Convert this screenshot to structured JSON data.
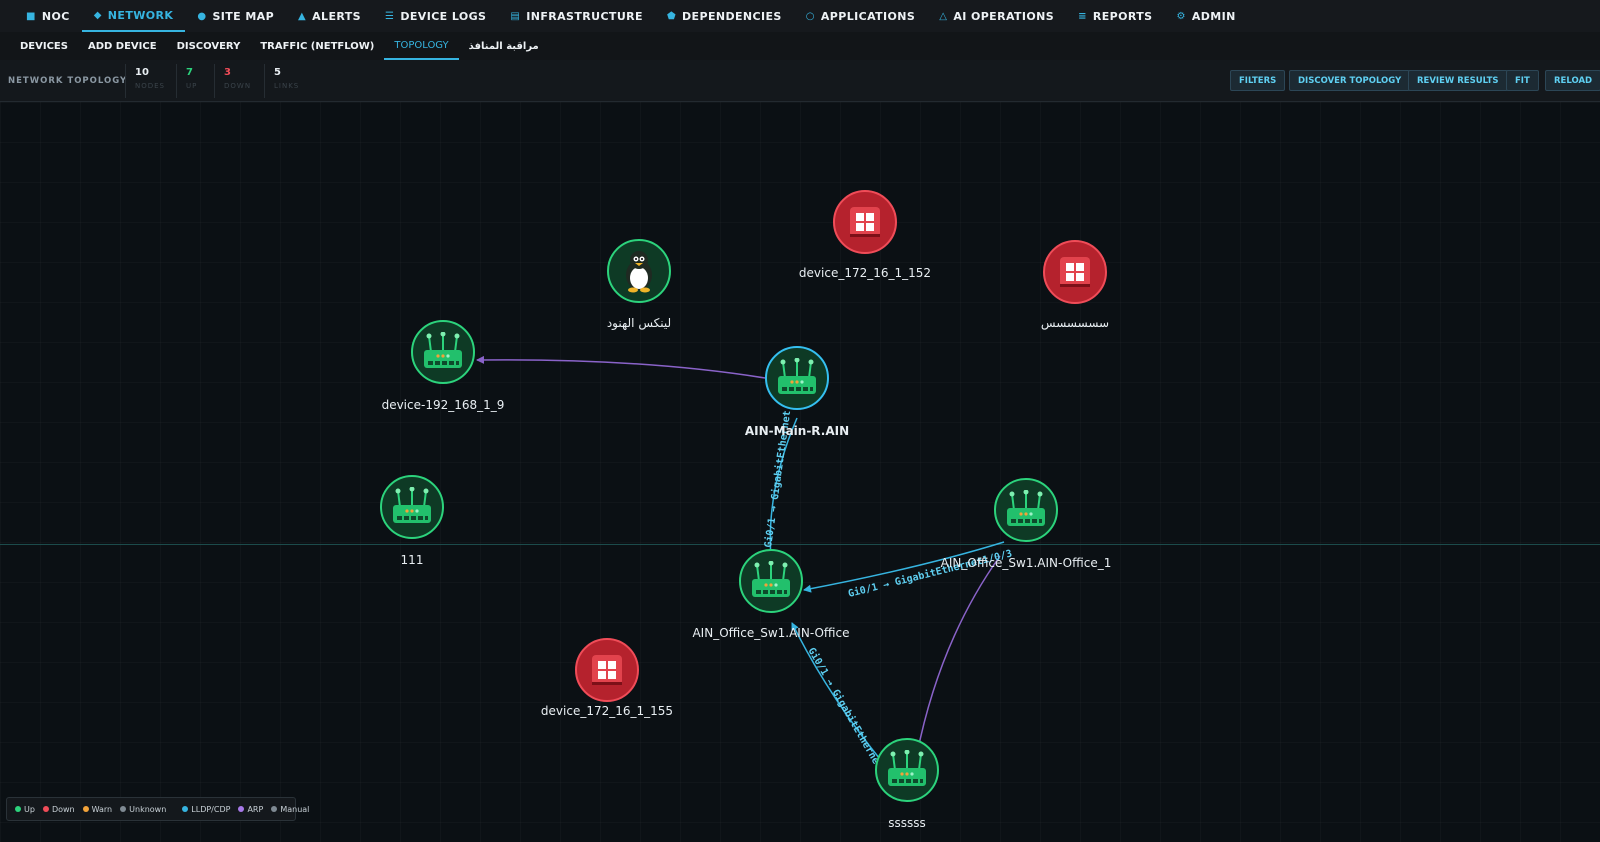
{
  "top_nav": [
    {
      "label": "NOC",
      "icon": "square-icon"
    },
    {
      "label": "NETWORK",
      "icon": "diamond-icon",
      "active": true
    },
    {
      "label": "SITE MAP",
      "icon": "globe-icon"
    },
    {
      "label": "ALERTS",
      "icon": "warning-icon"
    },
    {
      "label": "DEVICE LOGS",
      "icon": "list-icon"
    },
    {
      "label": "INFRASTRUCTURE",
      "icon": "server-icon"
    },
    {
      "label": "DEPENDENCIES",
      "icon": "pentagon-icon"
    },
    {
      "label": "APPLICATIONS",
      "icon": "circle-icon"
    },
    {
      "label": "AI OPERATIONS",
      "icon": "triangle-icon"
    },
    {
      "label": "REPORTS",
      "icon": "bars-icon"
    },
    {
      "label": "ADMIN",
      "icon": "gear-icon"
    }
  ],
  "sub_nav": [
    {
      "label": "DEVICES"
    },
    {
      "label": "ADD DEVICE"
    },
    {
      "label": "DISCOVERY"
    },
    {
      "label": "TRAFFIC (NETFLOW)"
    },
    {
      "label": "TOPOLOGY",
      "active": true
    },
    {
      "label": "مراقبة المنافذ"
    }
  ],
  "toolbar": {
    "title": "NETWORK TOPOLOGY",
    "stats": [
      {
        "value": "10",
        "label": "NODES",
        "color": "#e8eef2"
      },
      {
        "value": "7",
        "label": "UP",
        "color": "#2cd37c"
      },
      {
        "value": "3",
        "label": "DOWN",
        "color": "#f04c58"
      },
      {
        "value": "5",
        "label": "LINKS",
        "color": "#e8eef2"
      }
    ],
    "buttons": [
      "FILTERS",
      "DISCOVER TOPOLOGY",
      "REVIEW RESULTS",
      "FIT",
      "RELOAD"
    ]
  },
  "colors": {
    "up": "#2cd37c",
    "down": "#f04c58",
    "accent": "#36b4e0",
    "lldp": "#36b4e0",
    "arp": "#8a63c9"
  },
  "nodes": [
    {
      "id": "n1",
      "label": "device_172_16_1_152",
      "status": "down",
      "type": "windows-server"
    },
    {
      "id": "n2",
      "label": "لينكس الهنود",
      "status": "up",
      "type": "linux"
    },
    {
      "id": "n3",
      "label": "سسسسسس",
      "status": "down",
      "type": "windows-server"
    },
    {
      "id": "n4",
      "label": "device-192_168_1_9",
      "status": "up",
      "type": "router"
    },
    {
      "id": "n5",
      "label": "AIN-Main-R.AIN",
      "status": "selected",
      "type": "router"
    },
    {
      "id": "n6",
      "label": "111",
      "status": "up",
      "type": "router"
    },
    {
      "id": "n7",
      "label": "AIN_Office_Sw1.AIN-Office_1",
      "status": "up",
      "type": "router"
    },
    {
      "id": "n8",
      "label": "AIN_Office_Sw1.AIN-Office",
      "status": "up",
      "type": "router"
    },
    {
      "id": "n9",
      "label": "device_172_16_1_155",
      "status": "down",
      "type": "windows-server"
    },
    {
      "id": "n10",
      "label": "ssssss",
      "status": "up",
      "type": "router"
    }
  ],
  "links": [
    {
      "from": "n5",
      "to": "n4",
      "kind": "ARP",
      "label": ""
    },
    {
      "from": "n5",
      "to": "n8",
      "kind": "LLDP/CDP",
      "label": "Gi0/1 → GigabitEthernet"
    },
    {
      "from": "n7",
      "to": "n8",
      "kind": "LLDP/CDP",
      "label": "Gi0/1 → GigabitEthernet1/0/3"
    },
    {
      "from": "n10",
      "to": "n8",
      "kind": "LLDP/CDP",
      "label": "Gi0/1 → GigabitEthernet1"
    },
    {
      "from": "n7",
      "to": "n10",
      "kind": "ARP",
      "label": ""
    }
  ],
  "legend": [
    {
      "label": "Up",
      "color": "#2cd37c"
    },
    {
      "label": "Down",
      "color": "#f04c58"
    },
    {
      "label": "Warn",
      "color": "#f2a33a"
    },
    {
      "label": "Unknown",
      "color": "#7f8a93"
    },
    {
      "label": "LLDP/CDP",
      "color": "#36b4e0"
    },
    {
      "label": "ARP",
      "color": "#a779e8"
    },
    {
      "label": "Manual",
      "color": "#7f8a93"
    }
  ]
}
